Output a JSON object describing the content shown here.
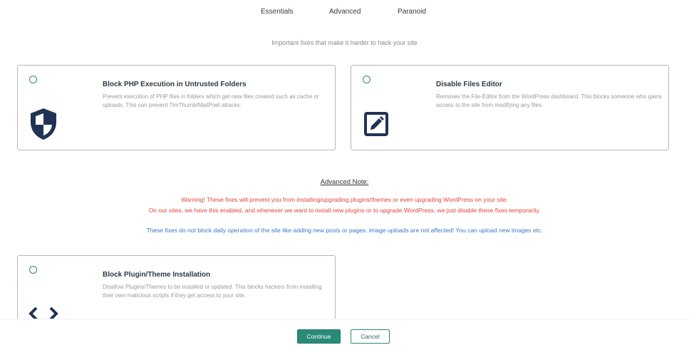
{
  "tabs": [
    {
      "label": "Essentials"
    },
    {
      "label": "Advanced"
    },
    {
      "label": "Paranoid"
    }
  ],
  "subtitle": "Important fixes that make it harder to hack your site",
  "cards": [
    {
      "title": "Block PHP Execution in Untrusted Folders",
      "description": "Prevent execution of PHP files in folders which get new files created such as cache or uploads. This can prevent TimThumb/MailPoet attacks.",
      "icon": "shield-icon"
    },
    {
      "title": "Disable Files Editor",
      "description": "Removes the File-Editor from the WordPress dashboard. This blocks someone who gains access to the site from modifying any files.",
      "icon": "edit-icon"
    },
    {
      "title": "Block Plugin/Theme Installation",
      "description": "Disallow Plugins/Themes to be installed or updated. This blocks hackers from installing their own malicious scripts if they get access to your site.",
      "icon": "code-icon"
    }
  ],
  "advanced_note": {
    "heading": "Advanced Note:",
    "warning_line1": "Warning! These fixes will prevent you from installing/upgrading plugins/themes or even upgrading WordPress on your site.",
    "warning_line2": "On our sites, we have this enabled, and whenever we want to install new plugins or to upgrade WordPress, we just disable these fixes temporarily.",
    "info": "These fixes do not block daily operation of the site like adding new posts or pages. Image uploads are not affected! You can upload new images etc."
  },
  "footer": {
    "continue_label": "Continue",
    "cancel_label": "Cancel"
  },
  "colors": {
    "accent": "#2a8a78",
    "icon": "#1f3354",
    "warning": "#e0453a",
    "info": "#3a78c4"
  }
}
